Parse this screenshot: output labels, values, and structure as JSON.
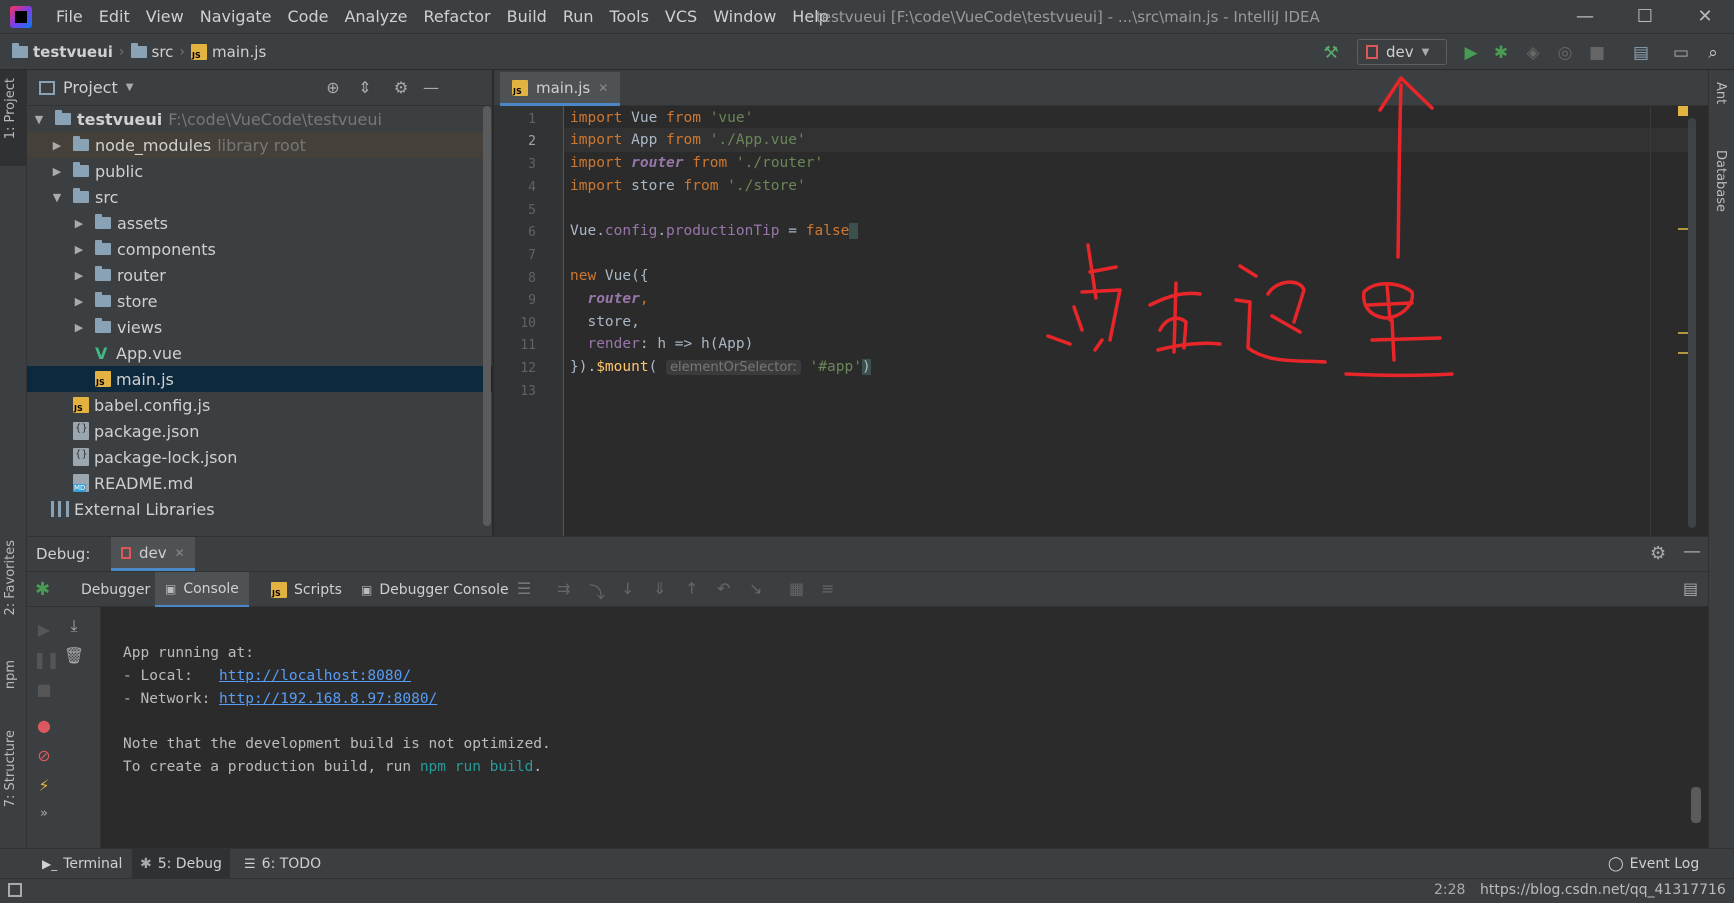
{
  "window": {
    "title": "testvueui [F:\\code\\VueCode\\testvueui] - ...\\src\\main.js - IntelliJ IDEA",
    "controls": [
      "—",
      "☐",
      "✕"
    ]
  },
  "menu": [
    "File",
    "Edit",
    "View",
    "Navigate",
    "Code",
    "Analyze",
    "Refactor",
    "Build",
    "Run",
    "Tools",
    "VCS",
    "Window",
    "Help"
  ],
  "breadcrumb": {
    "project": "testvueui",
    "folder": "src",
    "file": "main.js"
  },
  "toolbar": {
    "run_config": "dev"
  },
  "left_strip": {
    "project": "1: Project",
    "favorites": "2: Favorites",
    "npm": "npm",
    "structure": "7: Structure"
  },
  "right_strip": {
    "ant": "Ant",
    "database": "Database"
  },
  "project_panel": {
    "title": "Project",
    "tree": [
      {
        "label": "testvueui",
        "hint": "F:\\code\\VueCode\\testvueui"
      },
      {
        "label": "node_modules",
        "hint": "library root"
      },
      {
        "label": "public"
      },
      {
        "label": "src"
      },
      {
        "label": "assets"
      },
      {
        "label": "components"
      },
      {
        "label": "router"
      },
      {
        "label": "store"
      },
      {
        "label": "views"
      },
      {
        "label": "App.vue"
      },
      {
        "label": "main.js"
      },
      {
        "label": "babel.config.js"
      },
      {
        "label": "package.json"
      },
      {
        "label": "package-lock.json"
      },
      {
        "label": "README.md"
      },
      {
        "label": "External Libraries"
      }
    ]
  },
  "editor": {
    "tab": "main.js",
    "line_numbers": [
      "1",
      "2",
      "3",
      "4",
      "5",
      "6",
      "7",
      "8",
      "9",
      "10",
      "11",
      "12",
      "13"
    ],
    "code": {
      "l1": {
        "kw1": "import",
        "name": " Vue ",
        "kw2": "from",
        "str": " 'vue'"
      },
      "l2": {
        "kw1": "import",
        "name": " App ",
        "kw2": "from",
        "str": " './App.vue'"
      },
      "l3": {
        "kw1": "import",
        "name": "router",
        "kw2": "from",
        "str": " './router'"
      },
      "l4": {
        "kw1": "import",
        "name": " store ",
        "kw2": "from",
        "str": " './store'"
      },
      "l6": {
        "obj": "Vue.",
        "p1": "config",
        "dot": ".",
        "p2": "productionTip",
        "eq": " = ",
        "val": "false"
      },
      "l8": {
        "kw": "new",
        "rest": " Vue({"
      },
      "l9": {
        "prop": "router",
        "comma": ","
      },
      "l10": {
        "text": "  store,"
      },
      "l11": {
        "prop": "render",
        "rest": ": h => h(App)"
      },
      "l12": {
        "start": "}).",
        "fn": "$mount",
        "paren": "(",
        "hint": "elementOrSelector:",
        "str": "'#app'",
        "end": ")"
      }
    }
  },
  "annotation": {
    "text": "点击这里",
    "color": "#e8262a"
  },
  "debug": {
    "label": "Debug:",
    "session": "dev",
    "tabs": [
      "Debugger",
      "Console",
      "Scripts",
      "Debugger Console"
    ],
    "console": {
      "l1": "App running at:",
      "l2_prefix": "- Local:   ",
      "l2_link": "http://localhost:8080/",
      "l3_prefix": "- Network: ",
      "l3_link": "http://192.168.8.97:8080/",
      "l4": "Note that the development build is not optimized.",
      "l5_prefix": "To create a production build, run ",
      "l5_cmd": "npm run build",
      "l5_suffix": "."
    }
  },
  "bottom_tabs": {
    "terminal": "Terminal",
    "debug": "5: Debug",
    "todo": "6: TODO",
    "event_log": "Event Log"
  },
  "status": {
    "position": "2:28",
    "watermark": "https://blog.csdn.net/qq_41317716"
  }
}
